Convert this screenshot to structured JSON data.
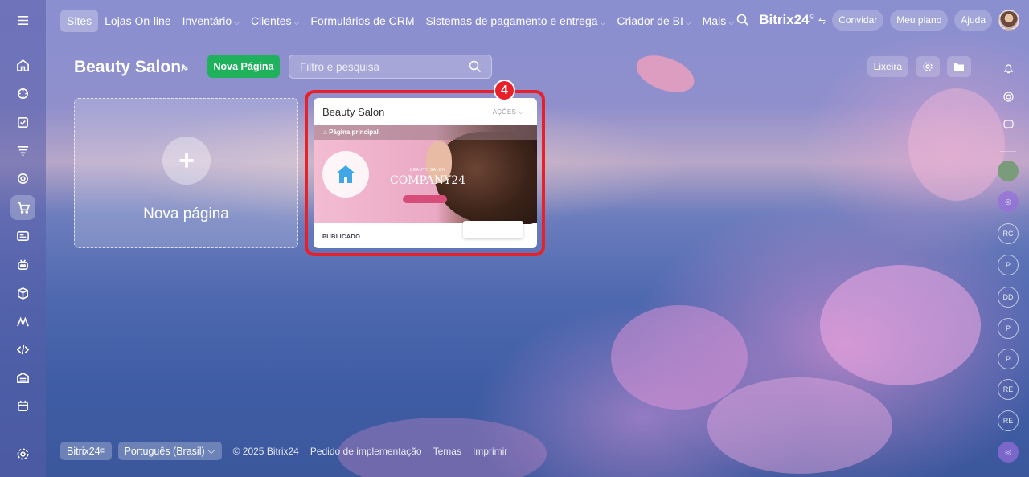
{
  "nav": {
    "items": [
      {
        "label": "Sites",
        "chev": ""
      },
      {
        "label": "Lojas On-line",
        "chev": ""
      },
      {
        "label": "Inventário",
        "chev": "⌵"
      },
      {
        "label": "Clientes",
        "chev": "⌵"
      },
      {
        "label": "Formulários de CRM",
        "chev": ""
      },
      {
        "label": "Sistemas de pagamento e entrega",
        "chev": "⌵"
      },
      {
        "label": "Criador de BI",
        "chev": "⌵"
      },
      {
        "label": "Mais",
        "chev": "⌵"
      }
    ]
  },
  "topbar": {
    "brand": "Bitrix24",
    "brand_mark": "©",
    "invite": "Convidar",
    "plan": "Meu plano",
    "help": "Ajuda"
  },
  "page": {
    "title": "Beauty Salon",
    "new_page_button": "Nova Página",
    "search_placeholder": "Filtro e pesquisa",
    "trash_label": "Lixeira"
  },
  "add_card": {
    "plus": "+",
    "label": "Nova página"
  },
  "site_card": {
    "title": "Beauty Salon",
    "actions": "AÇÕES",
    "preview_page": "Página principal",
    "preview_subtitle": "BEAUTY SALON",
    "preview_brand": "COMPANY24",
    "status": "PUBLICADO",
    "badge": "4"
  },
  "rail": {
    "labels": [
      "RC",
      "P",
      "DD",
      "P",
      "P",
      "RE",
      "RE"
    ]
  },
  "footer": {
    "brand": "Bitrix24",
    "brand_mark": "©",
    "language": "Português (Brasil)",
    "copyright": "© 2025 Bitrix24",
    "link1": "Pedido de implementação",
    "link2": "Temas",
    "link3": "Imprimir"
  },
  "colors": {
    "accent_green": "#20b15d",
    "highlight_red": "#e8202a"
  }
}
